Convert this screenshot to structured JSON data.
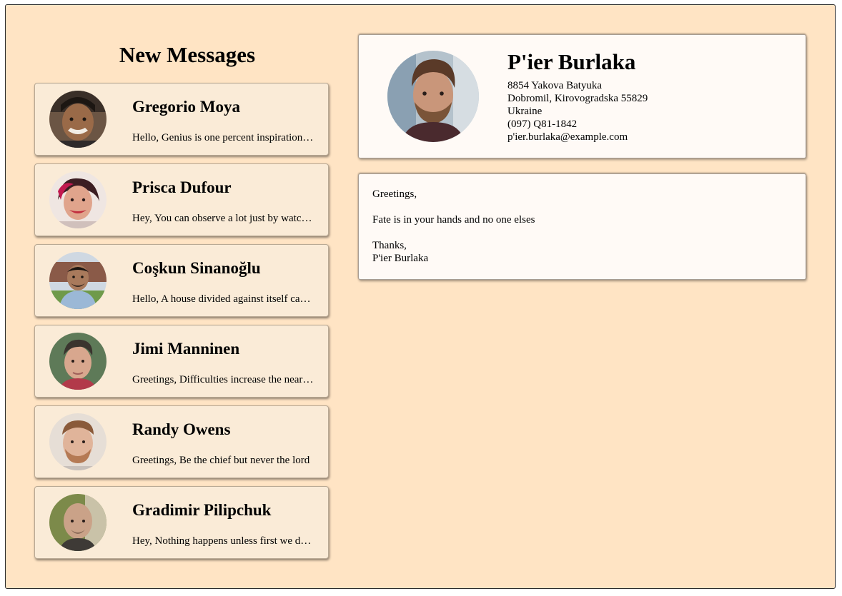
{
  "sidebar": {
    "title": "New Messages",
    "messages": [
      {
        "name": "Gregorio Moya",
        "preview": "Hello, Genius is one percent inspiration, ninety-nine percent perspiration"
      },
      {
        "name": "Prisca Dufour",
        "preview": "Hey, You can observe a lot just by watching"
      },
      {
        "name": "Coşkun Sinanoğlu",
        "preview": "Hello, A house divided against itself cannot stand"
      },
      {
        "name": "Jimi Manninen",
        "preview": "Greetings, Difficulties increase the nearer we get to the goal"
      },
      {
        "name": "Randy Owens",
        "preview": "Greetings, Be the chief but never the lord"
      },
      {
        "name": "Gradimir Pilipchuk",
        "preview": "Hey, Nothing happens unless first we dream"
      }
    ]
  },
  "profile": {
    "name": "P'ier Burlaka",
    "street": "8854 Yakova Batyuka",
    "city_line": "Dobromil, Kirovogradska 55829",
    "country": "Ukraine",
    "phone": "(097) Q81-1842",
    "email": "p'ier.burlaka@example.com"
  },
  "message_body": {
    "greeting": "Greetings,",
    "text": "Fate is in your hands and no one elses",
    "signoff": "Thanks,",
    "signature": "P'ier Burlaka"
  },
  "colors": {
    "background": "#ffe4c4",
    "card": "#faebd7",
    "detail_card": "#fffaf6"
  }
}
